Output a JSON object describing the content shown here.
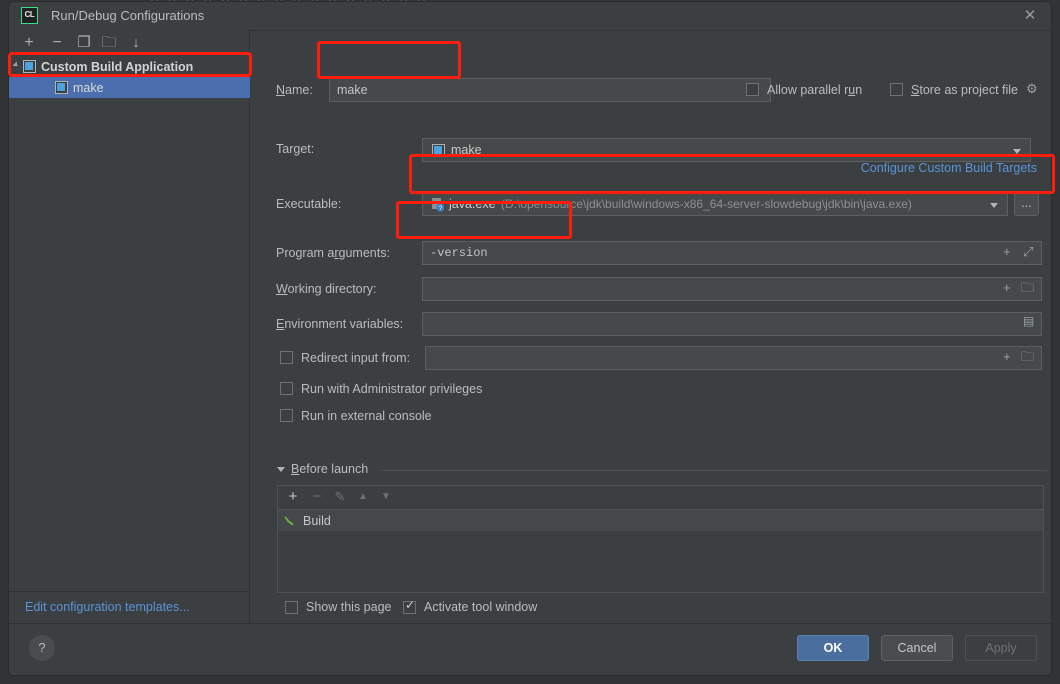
{
  "window": {
    "title": "Run/Debug Configurations",
    "app_icon": "CL",
    "close_icon": "✕"
  },
  "backdrop": {
    "ghost_text": "Y Y Y Y Y Y Y Y Y Y Y Y Y Y Y Y"
  },
  "sidebar": {
    "toolbar": [
      {
        "name": "add-configuration-button",
        "glyph": "+"
      },
      {
        "name": "remove-configuration-button",
        "glyph": "−"
      },
      {
        "name": "copy-configuration-button",
        "glyph": "❐"
      },
      {
        "name": "save-configuration-button",
        "glyph": "🗀"
      },
      {
        "name": "sort-configurations-button",
        "glyph": "↓"
      }
    ],
    "tree": [
      {
        "label": "Custom Build Application",
        "type": "group",
        "expanded": true
      },
      {
        "label": "make",
        "type": "child",
        "selected": true
      }
    ],
    "footer_link": "Edit configuration templates..."
  },
  "form": {
    "name": {
      "label": "Name:",
      "label_mnemonic": "N",
      "value": "make"
    },
    "allow_parallel_run": {
      "label": "Allow parallel run",
      "checked": false
    },
    "store_as_project_file": {
      "label": "Store as project file",
      "checked": false,
      "gear_icon": "⚙"
    },
    "target": {
      "label": "Target:",
      "value": "make",
      "configure_link": "Configure Custom Build Targets"
    },
    "executable": {
      "label": "Executable:",
      "value_name": "java.exe",
      "value_path": "(D:\\opensource\\jdk\\build\\windows-x86_64-server-slowdebug\\jdk\\bin\\java.exe)",
      "browse_button": "..."
    },
    "program_arguments": {
      "label": "Program arguments:",
      "label_mnemonic": "r",
      "value": "-version",
      "insert_macro_icon": "+",
      "expand_icon": "⤢"
    },
    "working_directory": {
      "label": "Working directory:",
      "label_mnemonic": "W",
      "value": "",
      "insert_macro_icon": "+",
      "browse_icon": "🗀"
    },
    "environment_variables": {
      "label": "Environment variables:",
      "label_mnemonic": "E",
      "value": "",
      "edit_icon": "▤"
    },
    "redirect_input_from": {
      "label": "Redirect input from:",
      "checked": false,
      "value": "",
      "insert_macro_icon": "+",
      "browse_icon": "🗀"
    },
    "run_as_administrator": {
      "label": "Run with Administrator privileges",
      "checked": false
    },
    "run_in_external_console": {
      "label": "Run in external console",
      "checked": false
    }
  },
  "before_launch": {
    "title": "Before launch",
    "title_mnemonic": "B",
    "toolbar": [
      {
        "name": "add-task-button",
        "glyph": "+",
        "enabled": true
      },
      {
        "name": "remove-task-button",
        "glyph": "−",
        "enabled": false
      },
      {
        "name": "edit-task-button",
        "glyph": "✎",
        "enabled": false
      },
      {
        "name": "move-task-up-button",
        "glyph": "▲",
        "enabled": false
      },
      {
        "name": "move-task-down-button",
        "glyph": "▼",
        "enabled": false
      }
    ],
    "tasks": [
      {
        "label": "Build",
        "icon": "hammer-icon"
      }
    ],
    "show_this_page": {
      "label": "Show this page",
      "checked": false
    },
    "activate_tool_window": {
      "label": "Activate tool window",
      "checked": true
    }
  },
  "footer": {
    "help_glyph": "?",
    "ok": "OK",
    "cancel": "Cancel",
    "apply": "Apply"
  },
  "colors": {
    "accent_blue": "#4b6eaf",
    "link_blue": "#5a93d8",
    "annotation_red": "#fc1d0e",
    "panel_bg": "#3c3f41",
    "field_bg": "#45494a"
  },
  "annotations": [
    {
      "name": "annotation-sidebar-group"
    },
    {
      "name": "annotation-name-field"
    },
    {
      "name": "annotation-executable-field"
    },
    {
      "name": "annotation-program-arguments-field"
    }
  ]
}
